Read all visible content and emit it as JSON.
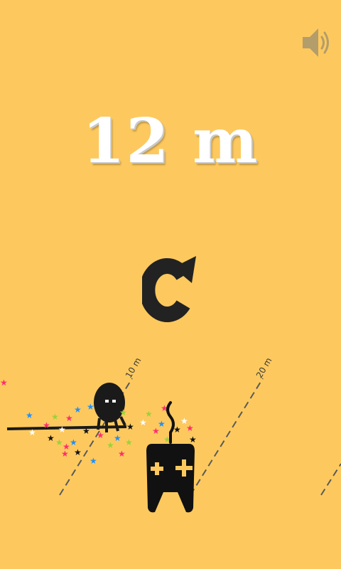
{
  "hud": {
    "distance_text": "12 m",
    "sound_icon": "speaker-icon",
    "restart_icon": "restart-arrow-icon"
  },
  "track": {
    "markers": [
      {
        "label": "10 m"
      },
      {
        "label": "20 m"
      }
    ]
  },
  "controls": {
    "gamepad_icon": "gamepad-icon"
  },
  "colors": {
    "background": "#fdc95e",
    "ink": "#111111",
    "marker_line": "#555555",
    "sound_icon": "#b8a06a"
  }
}
